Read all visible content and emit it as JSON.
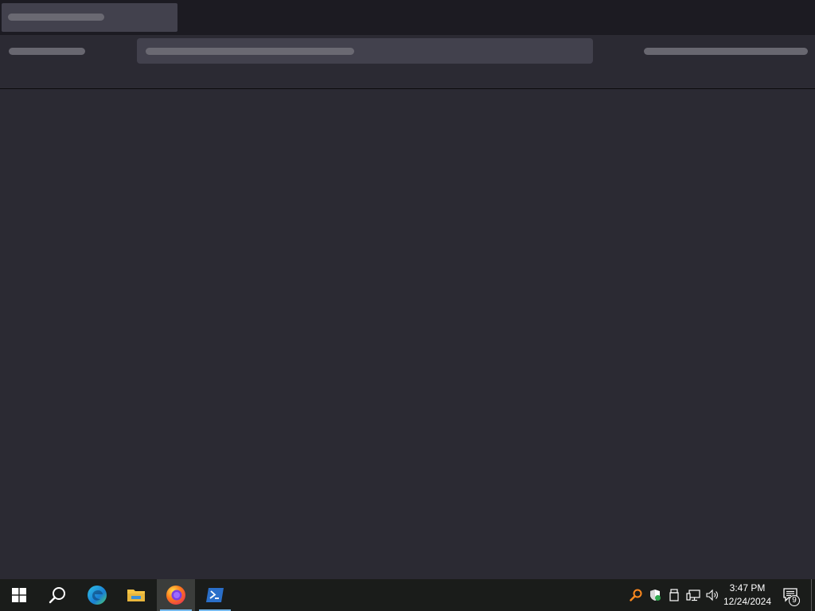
{
  "browser": {
    "tabs": [
      {
        "label": ""
      }
    ],
    "url": "",
    "colors": {
      "tabstrip": "#1c1b22",
      "toolbar": "#2b2a33",
      "tab_active": "#42414d"
    }
  },
  "taskbar": {
    "apps": [
      {
        "name": "start",
        "icon": "windows-logo-icon"
      },
      {
        "name": "search",
        "icon": "search-icon"
      },
      {
        "name": "edge",
        "icon": "edge-icon"
      },
      {
        "name": "file-explorer",
        "icon": "folder-icon"
      },
      {
        "name": "firefox",
        "icon": "firefox-icon",
        "active": true
      },
      {
        "name": "powershell",
        "icon": "powershell-icon",
        "running": true
      }
    ],
    "tray": {
      "icons": [
        "search-magnifier-icon",
        "security-shield-icon",
        "usb-drive-icon",
        "network-icon",
        "volume-icon"
      ],
      "time": "3:47 PM",
      "date": "12/24/2024",
      "notification_count": "9"
    }
  }
}
